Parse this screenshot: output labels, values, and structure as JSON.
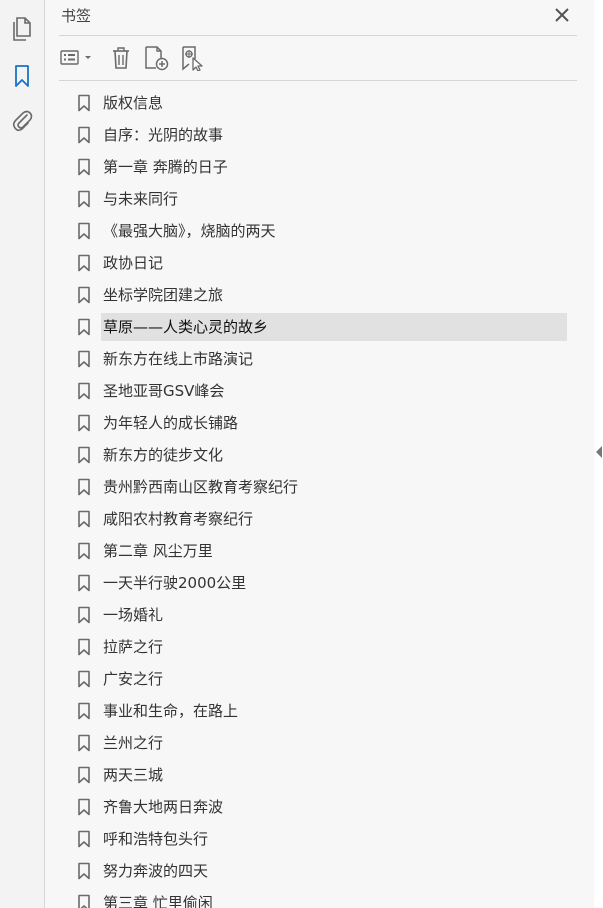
{
  "panel": {
    "title": "书签"
  },
  "rail": {
    "items": [
      {
        "icon": "pages-icon"
      },
      {
        "icon": "bookmark-icon",
        "active": true
      },
      {
        "icon": "attachment-icon"
      }
    ]
  },
  "toolbar": {
    "items": [
      "options-menu-icon",
      "trash-icon",
      "new-bookmark-icon",
      "bookmark-from-selection-icon"
    ]
  },
  "colors": {
    "accent": "#1a73c8",
    "icon_gray": "#6a6a6a",
    "selected_bg": "#e1e1e1"
  },
  "bookmarks": [
    "版权信息",
    "自序：光阴的故事",
    "第一章 奔腾的日子",
    "与未来同行",
    "《最强大脑》，烧脑的两天",
    "政协日记",
    "坐标学院团建之旅",
    "草原——人类心灵的故乡",
    "新东方在线上市路演记",
    "圣地亚哥GSV峰会",
    "为年轻人的成长铺路",
    "新东方的徒步文化",
    "贵州黔西南山区教育考察纪行",
    "咸阳农村教育考察纪行",
    "第二章 风尘万里",
    "一天半行驶2000公里",
    "一场婚礼",
    "拉萨之行",
    "广安之行",
    "事业和生命，在路上",
    "兰州之行",
    "两天三城",
    "齐鲁大地两日奔波",
    "呼和浩特包头行",
    "努力奔波的四天",
    "第三章 忙里偷闲"
  ],
  "selected_index": 7
}
